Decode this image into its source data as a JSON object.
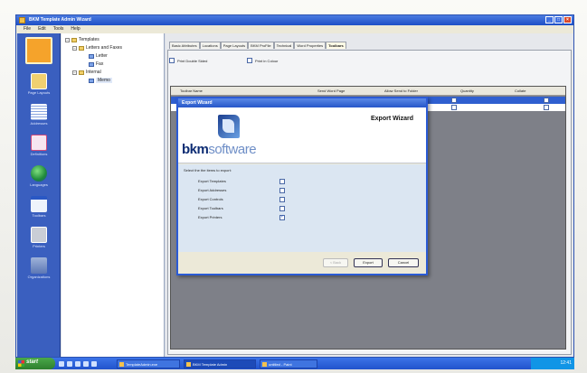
{
  "window": {
    "title": "BKM Template Admin Wizard"
  },
  "menu": [
    "File",
    "Edit",
    "Tools",
    "Help"
  ],
  "sidebar": [
    {
      "label": "Templates",
      "icon": "template-icon"
    },
    {
      "label": "Page Layouts",
      "icon": "page-layout-icon"
    },
    {
      "label": "Addresses",
      "icon": "address-icon"
    },
    {
      "label": "Definitions",
      "icon": "definitions-icon"
    },
    {
      "label": "Languages",
      "icon": "globe-icon"
    },
    {
      "label": "Toolbars",
      "icon": "toolbar-icon"
    },
    {
      "label": "Printers",
      "icon": "printer-icon"
    },
    {
      "label": "Organizations",
      "icon": "organization-icon"
    }
  ],
  "tree": {
    "root": "Templates",
    "group1": "Letters and Faxes",
    "letter": "Letter",
    "fax": "Fax",
    "group2": "Internal",
    "memo": "Memo"
  },
  "tabs": [
    "Basic Attributes",
    "Locations",
    "Page Layouts",
    "BKM ProFile",
    "Technical",
    "Word Properties",
    "Toolbars"
  ],
  "active_tab": "Toolbars",
  "options": {
    "print_double_sided": "Print Double Sided",
    "print_in_colour": "Print in Colour"
  },
  "grid": {
    "headers": [
      "Toolbar Name",
      "Send Word Page",
      "Allow Send to Folder",
      "Quantity",
      "Collate"
    ]
  },
  "dialog": {
    "title": "Export Wizard",
    "heading": "Export Wizard",
    "brand_bold": "bkm",
    "brand_rest": "software",
    "prompt": "Select the the items to export:",
    "items": [
      {
        "label": "Export Templates",
        "checked": false
      },
      {
        "label": "Export Addresses",
        "checked": false
      },
      {
        "label": "Export Controls",
        "checked": false
      },
      {
        "label": "Export Toolbars",
        "checked": false
      },
      {
        "label": "Export Printers",
        "checked": true
      }
    ],
    "back_button": "< Back",
    "export_button": "Export",
    "cancel_button": "Cancel"
  },
  "taskbar": {
    "start": "start",
    "buttons": [
      "TemplateAdmin.exe",
      "BKM Template Admin",
      "untitled - Paint"
    ],
    "clock": "12:41"
  },
  "colors": {
    "accent": "#2656c9",
    "sidebar": "#3a5fbf",
    "selected_row": "#2f5fd0"
  }
}
